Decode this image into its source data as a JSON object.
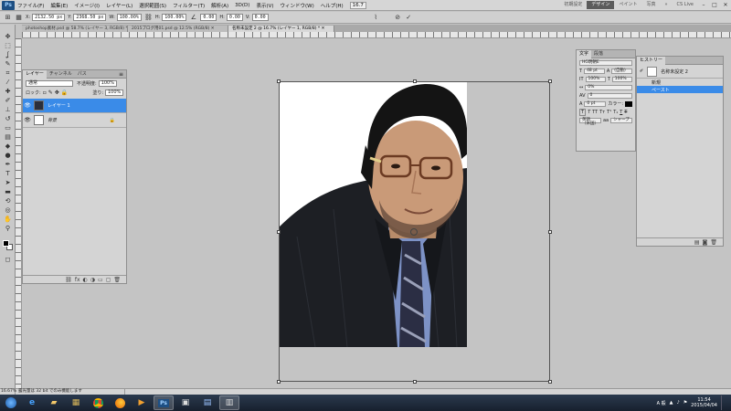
{
  "menubar": {
    "logo": "Ps",
    "items": [
      "ファイル(F)",
      "編集(E)",
      "イメージ(I)",
      "レイヤー(L)",
      "選択範囲(S)",
      "フィルター(T)",
      "解析(A)",
      "3D(D)",
      "表示(V)",
      "ウィンドウ(W)",
      "ヘルプ(H)"
    ],
    "zoom": "16.7",
    "workspaces": [
      "初期設定",
      "デザイン",
      "ペイント",
      "写真"
    ],
    "cslive": "CS Live"
  },
  "options": {
    "x_label": "X:",
    "x_value": "2132.50 px",
    "y_label": "Y:",
    "y_value": "2368.50 px",
    "w_label": "W:",
    "w_value": "100.00%",
    "h_label": "H:",
    "h_value": "100.00%",
    "angle_value": "0.00",
    "hskew_label": "H:",
    "hskew_value": "0.00",
    "vskew_label": "V:",
    "vskew_value": "0.00"
  },
  "tabs": [
    "photoshop素材.psd @ 58.7% (レイヤー 3, RGB/8) * ✕",
    "2015ブログ用01.psd @ 12.5% (RGB/8) ✕",
    "名称未設定 2 @ 16.7% (レイヤー 1, RGB/8) * ✕"
  ],
  "layers": {
    "tabs": [
      "レイヤー",
      "チャンネル",
      "パス"
    ],
    "blend_mode": "通常",
    "opacity_label": "不透明度:",
    "opacity_value": "100%",
    "lock_label": "ロック:",
    "fill_label": "塗り:",
    "fill_value": "100%",
    "items": [
      {
        "name": "レイヤー 1",
        "selected": true
      },
      {
        "name": "背景",
        "selected": false
      }
    ]
  },
  "character": {
    "tabs": [
      "文字",
      "段落"
    ],
    "font": "HG明朝E",
    "size": "48 pt",
    "leading": "(自動)",
    "scale_v": "100%",
    "scale_h": "100%",
    "tracking": "0%",
    "kerning": "0",
    "baseline": "0 pt",
    "color_label": "カラー:",
    "lang": "英語（米国）",
    "aa": "aa",
    "aa_mode": "シャープ"
  },
  "history": {
    "title": "ヒストリー",
    "snapshot": "名称未設定 2",
    "items": [
      {
        "label": "新規",
        "selected": false
      },
      {
        "label": "ペースト",
        "selected": true
      }
    ]
  },
  "status": {
    "zoom": "16.67%",
    "info": "露光量は 32 bit でのみ機能します"
  },
  "taskbar": {
    "time": "11:54",
    "date": "2015/04/04",
    "ime": "A 般"
  },
  "colors": {
    "selection": "#3a8be8",
    "panel": "#d4d4d4",
    "workspace": "#c4c4c4"
  }
}
